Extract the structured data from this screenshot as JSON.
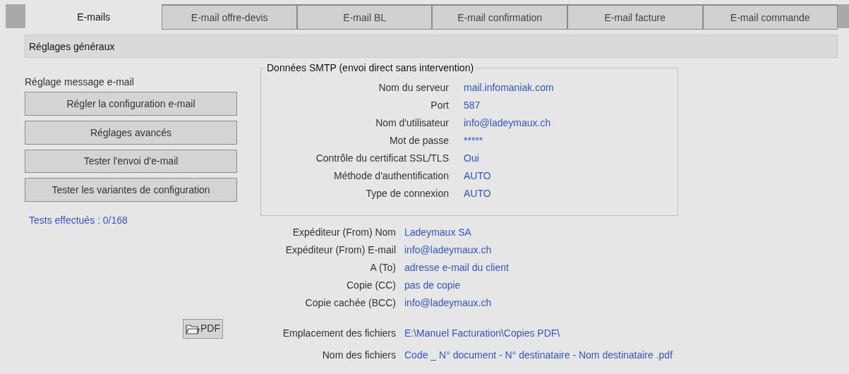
{
  "tabs": [
    {
      "label": "E-mails",
      "selected": true
    },
    {
      "label": "E-mail offre-devis",
      "selected": false
    },
    {
      "label": "E-mail BL",
      "selected": false
    },
    {
      "label": "E-mail confirmation",
      "selected": false
    },
    {
      "label": "E-mail facture",
      "selected": false
    },
    {
      "label": "E-mail commande",
      "selected": false
    }
  ],
  "section_title": "Réglages généraux",
  "message_settings": {
    "heading": "Réglage message e-mail",
    "buttons": [
      "Régler la configuration e-mail",
      "Réglages avancés",
      "Tester l'envoi d'e-mail",
      "Tester les variantes de configuration"
    ],
    "tests_status": "Tests effectués : 0/168"
  },
  "smtp": {
    "title": "Données SMTP (envoi direct sans intervention)",
    "rows": [
      {
        "label": "Nom du serveur",
        "value": "mail.infomaniak.com"
      },
      {
        "label": "Port",
        "value": "587"
      },
      {
        "label": "Nom d'utilisateur",
        "value": "info@ladeymaux.ch"
      },
      {
        "label": "Mot de passe",
        "value": "*****"
      },
      {
        "label": "Contrôle du certificat SSL/TLS",
        "value": "Oui"
      },
      {
        "label": "Méthode d'authentification",
        "value": "AUTO"
      },
      {
        "label": "Type de connexion",
        "value": "AUTO"
      }
    ]
  },
  "addresses": [
    {
      "label": "Expéditeur (From) Nom",
      "value": "Ladeymaux SA"
    },
    {
      "label": "Expéditeur (From) E-mail",
      "value": "info@ladeymaux.ch"
    },
    {
      "label": "A (To)",
      "value": "adresse e-mail du client"
    },
    {
      "label": "Copie (CC)",
      "value": "pas de copie"
    },
    {
      "label": "Copie cachée (BCC)",
      "value": "info@ladeymaux.ch"
    }
  ],
  "files": {
    "pdf_button": "PDF",
    "rows": [
      {
        "label": "Emplacement des  fichiers",
        "value": "E:\\Manuel Facturation\\Copies PDF\\"
      },
      {
        "label": "Nom des fichiers",
        "value": "Code _ N° document - N° destinataire - Nom destinataire .pdf"
      }
    ]
  }
}
